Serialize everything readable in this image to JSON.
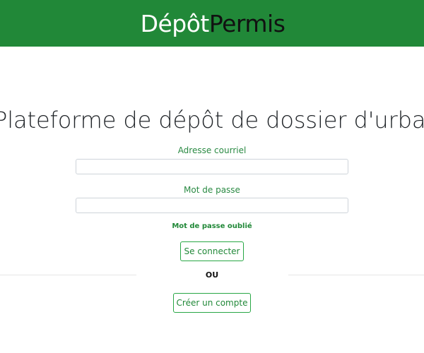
{
  "header": {
    "brand_part1": "Dépôt",
    "brand_part2": "Permis",
    "background_color": "#218838"
  },
  "main": {
    "headline": "Plateforme de dépôt de dossier d'urbanisme",
    "email_label": "Adresse courriel",
    "email_value": "",
    "password_label": "Mot de passe",
    "password_value": "",
    "forgot_password_link": "Mot de passe oublié",
    "login_button": "Se connecter",
    "divider_text": "OU",
    "create_account_button": "Créer un compte",
    "accent_color": "#28a745"
  }
}
